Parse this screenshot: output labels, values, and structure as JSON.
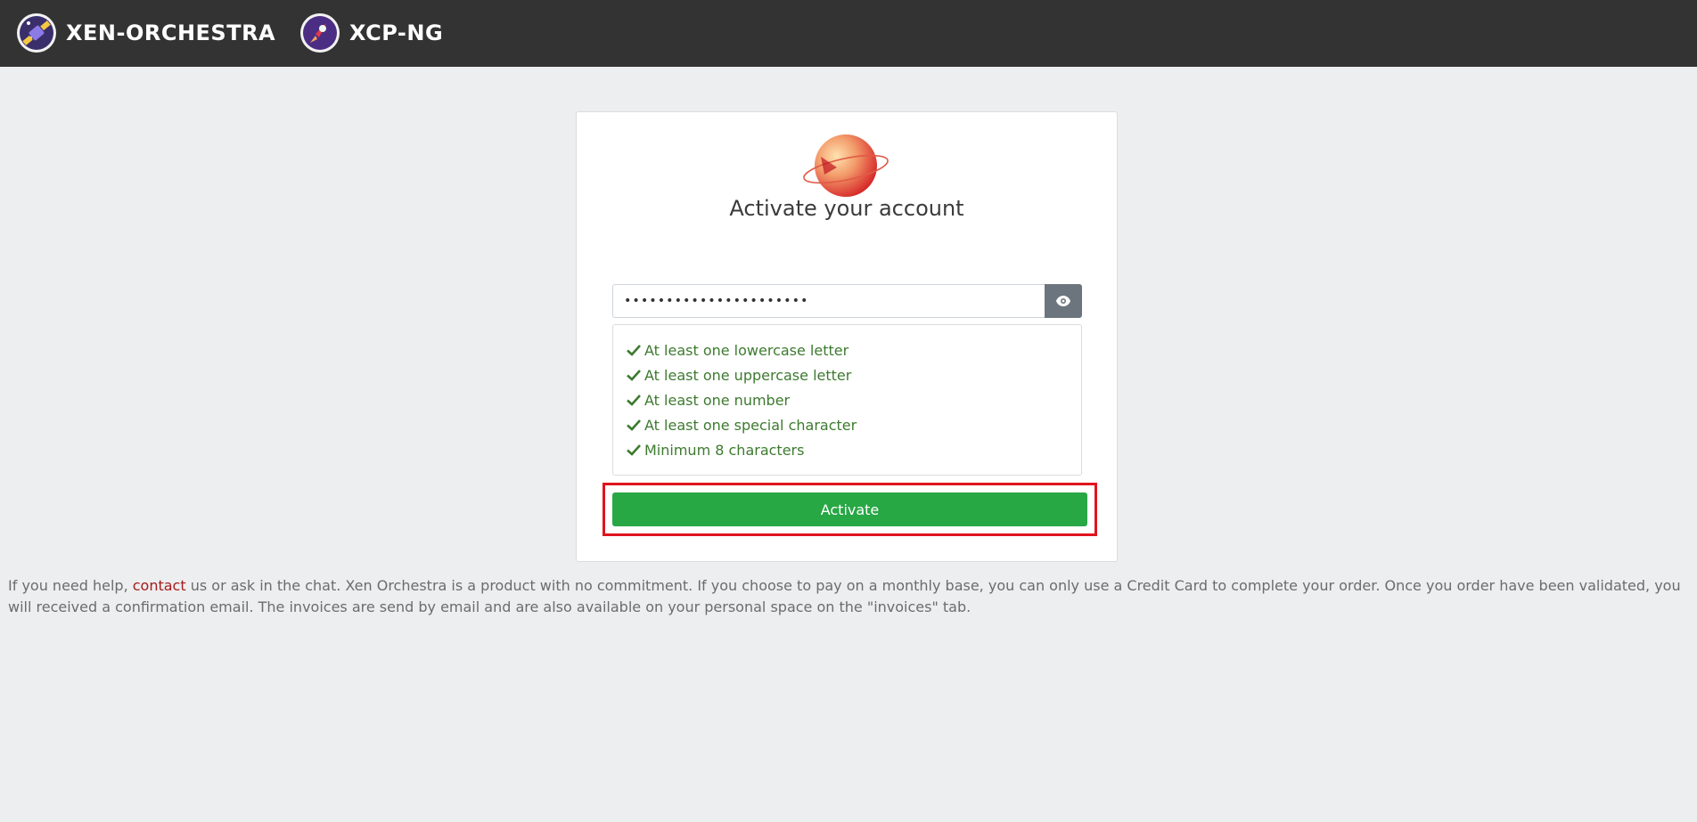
{
  "header": {
    "brands": [
      {
        "name": "XEN-ORCHESTRA",
        "icon": "xo-satellite-logo"
      },
      {
        "name": "XCP-NG",
        "icon": "xcpng-rocket-logo"
      }
    ]
  },
  "card": {
    "logo_icon": "planet-logo",
    "title": "Activate your account",
    "password_value": "••••••••••••••••••••••",
    "toggle_icon": "eye-icon",
    "rules": [
      "At least one lowercase letter",
      "At least one uppercase letter",
      "At least one number",
      "At least one special character",
      "Minimum 8 characters"
    ],
    "activate_label": "Activate"
  },
  "footer": {
    "before_link": "If you need help, ",
    "link": "contact",
    "after_link": " us or ask in the chat. Xen Orchestra is a product with no commitment. If you choose to pay on a monthly base, you can only use a Credit Card to complete your order. Once you order have been validated, you will received a confirmation email. The invoices are send by email and are also available on your personal space on the \"invoices\" tab."
  },
  "colors": {
    "topbar": "#333333",
    "success": "#28a745",
    "rule_ok": "#3d7a2f",
    "highlight": "#e0141e",
    "link": "#a51b1b"
  }
}
